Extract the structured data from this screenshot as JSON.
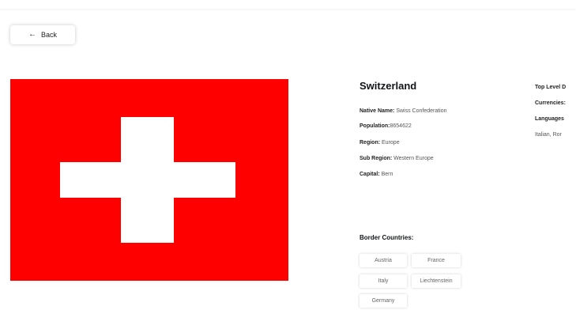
{
  "back_button": {
    "label": "Back",
    "icon": "arrow-left-icon"
  },
  "flag": {
    "icon": "swiss-flag",
    "background_color": "#ff0000",
    "cross_color": "#ffffff"
  },
  "country": {
    "name": "Switzerland",
    "native_name_label": "Native Name:",
    "native_name": "Swiss Confederation",
    "population_label": "Population:",
    "population": "8654622",
    "region_label": "Region:",
    "region": "Europe",
    "sub_region_label": "Sub Region:",
    "sub_region": "Western Europe",
    "capital_label": "Capital:",
    "capital": "Bern",
    "top_level_label": "Top Level D",
    "currencies_label": "Currencies:",
    "languages_label": "Languages",
    "languages_value": "Italian, Ror"
  },
  "border": {
    "title": "Border Countries:",
    "countries": [
      "Austria",
      "France",
      "Italy",
      "Liechtenstein",
      "Germany"
    ]
  }
}
